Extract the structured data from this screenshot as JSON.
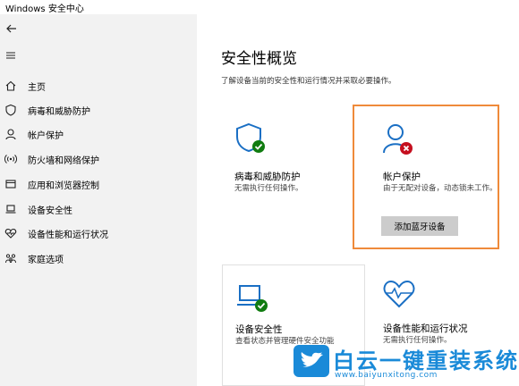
{
  "window": {
    "title": "Windows 安全中心"
  },
  "sidebar": {
    "items": [
      {
        "label": "主页",
        "icon": "home-icon"
      },
      {
        "label": "病毒和威胁防护",
        "icon": "shield-icon"
      },
      {
        "label": "帐户保护",
        "icon": "person-icon"
      },
      {
        "label": "防火墙和网络保护",
        "icon": "wifi-icon"
      },
      {
        "label": "应用和浏览器控制",
        "icon": "app-window-icon"
      },
      {
        "label": "设备安全性",
        "icon": "laptop-icon"
      },
      {
        "label": "设备性能和运行状况",
        "icon": "heart-icon"
      },
      {
        "label": "家庭选项",
        "icon": "family-icon"
      }
    ]
  },
  "main": {
    "title": "安全性概览",
    "subtitle": "了解设备当前的安全性和运行情况并采取必要操作。",
    "cards": [
      {
        "title": "病毒和威胁防护",
        "desc": "无需执行任何操作。",
        "status": "ok"
      },
      {
        "title": "帐户保护",
        "desc": "由于无配对设备，动态锁未工作。",
        "status": "error",
        "button": "添加蓝牙设备"
      },
      {
        "title": "设备安全性",
        "desc": "查看状态并管理硬件安全功能",
        "status": "ok"
      },
      {
        "title": "设备性能和运行状况",
        "desc": "无需执行任何操作。",
        "status": "ok"
      }
    ]
  },
  "watermark": {
    "text": "白云一键重装系统",
    "url": "www.baiyunxitong.com"
  },
  "colors": {
    "accent": "#1a6fc4",
    "ok": "#107c10",
    "error": "#c50f1f",
    "highlight": "#ef8a3a",
    "sidebar_bg": "#f2f2f2"
  }
}
